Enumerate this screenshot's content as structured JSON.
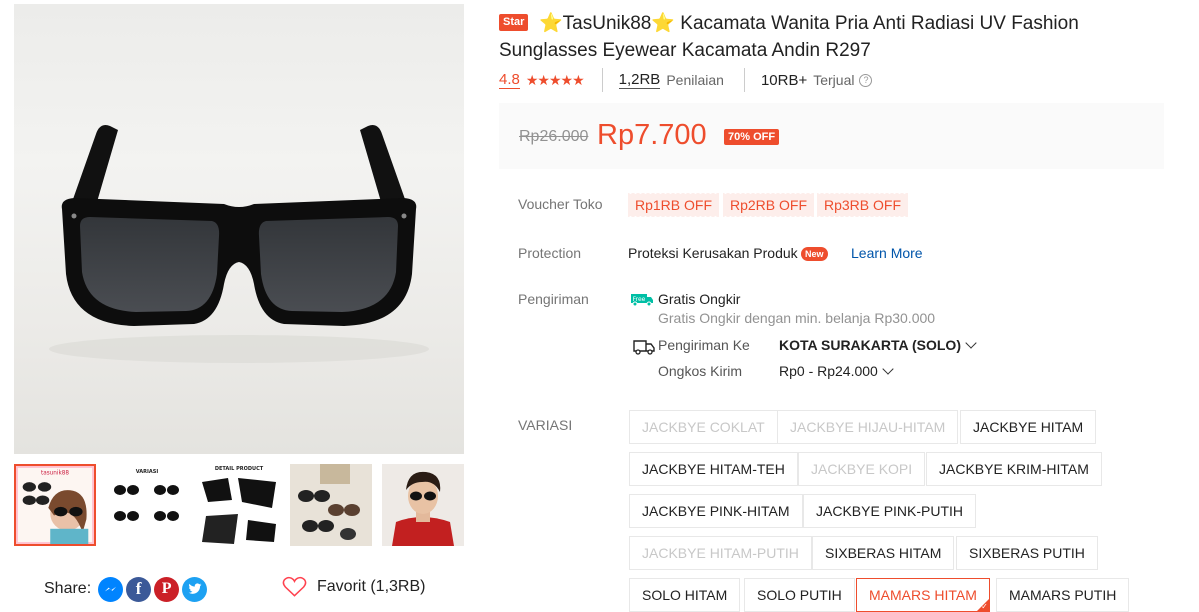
{
  "gallery": {
    "main_image_alt": "black sunglasses",
    "thumbnails": [
      {
        "name": "thumb-model-woman",
        "caption": "tasunik88"
      },
      {
        "name": "thumb-variants",
        "caption": "VARIASI"
      },
      {
        "name": "thumb-detail",
        "caption": "DETAIL PRODUCT"
      },
      {
        "name": "thumb-collection",
        "caption": ""
      },
      {
        "name": "thumb-model-man",
        "caption": ""
      }
    ],
    "share_label": "Share:",
    "favorite_label": "Favorit (1,3RB)"
  },
  "product": {
    "badge": "Star",
    "title": "⭐TasUnik88⭐ Kacamata Wanita Pria Anti Radiasi UV Fashion Sunglasses Eyewear Kacamata Andin R297",
    "rating": "4.8",
    "rating_stars": 4.8,
    "reviews_count": "1,2RB",
    "reviews_label": "Penilaian",
    "sold_count": "10RB+",
    "sold_label": "Terjual"
  },
  "price": {
    "old": "Rp26.000",
    "current": "Rp7.700",
    "discount": "70% OFF"
  },
  "voucher": {
    "label": "Voucher Toko",
    "items": [
      "Rp1RB OFF",
      "Rp2RB OFF",
      "Rp3RB OFF"
    ]
  },
  "protection": {
    "label": "Protection",
    "text": "Proteksi Kerusakan Produk",
    "badge": "New",
    "link": "Learn More"
  },
  "shipping": {
    "label": "Pengiriman",
    "free_icon_text": "Free",
    "free_title": "Gratis Ongkir",
    "free_sub": "Gratis Ongkir dengan min. belanja Rp30.000",
    "to_label": "Pengiriman Ke",
    "to_value": "KOTA SURAKARTA (SOLO)",
    "cost_label": "Ongkos Kirim",
    "cost_value": "Rp0 - Rp24.000"
  },
  "variations": {
    "label": "VARIASI",
    "options": [
      {
        "label": "JACKBYE COKLAT",
        "state": "disabled"
      },
      {
        "label": "JACKBYE HIJAU-HITAM",
        "state": "disabled"
      },
      {
        "label": "JACKBYE HITAM",
        "state": "normal"
      },
      {
        "label": "JACKBYE HITAM-TEH",
        "state": "normal"
      },
      {
        "label": "JACKBYE KOPI",
        "state": "disabled"
      },
      {
        "label": "JACKBYE KRIM-HITAM",
        "state": "normal"
      },
      {
        "label": "JACKBYE PINK-HITAM",
        "state": "normal"
      },
      {
        "label": "JACKBYE PINK-PUTIH",
        "state": "normal"
      },
      {
        "label": "JACKBYE HITAM-PUTIH",
        "state": "disabled"
      },
      {
        "label": "SIXBERAS HITAM",
        "state": "normal"
      },
      {
        "label": "SIXBERAS PUTIH",
        "state": "normal"
      },
      {
        "label": "SOLO HITAM",
        "state": "normal"
      },
      {
        "label": "SOLO PUTIH",
        "state": "normal"
      },
      {
        "label": "MAMARS HITAM",
        "state": "selected"
      },
      {
        "label": "MAMARS PUTIH",
        "state": "normal"
      }
    ]
  },
  "colors": {
    "accent": "#ee4d2d",
    "link": "#0055aa",
    "facebook": "#3b5998",
    "messenger": "#0084ff",
    "pinterest": "#cb2027",
    "twitter": "#1da1f2",
    "free_badge": "#00bfa5"
  }
}
